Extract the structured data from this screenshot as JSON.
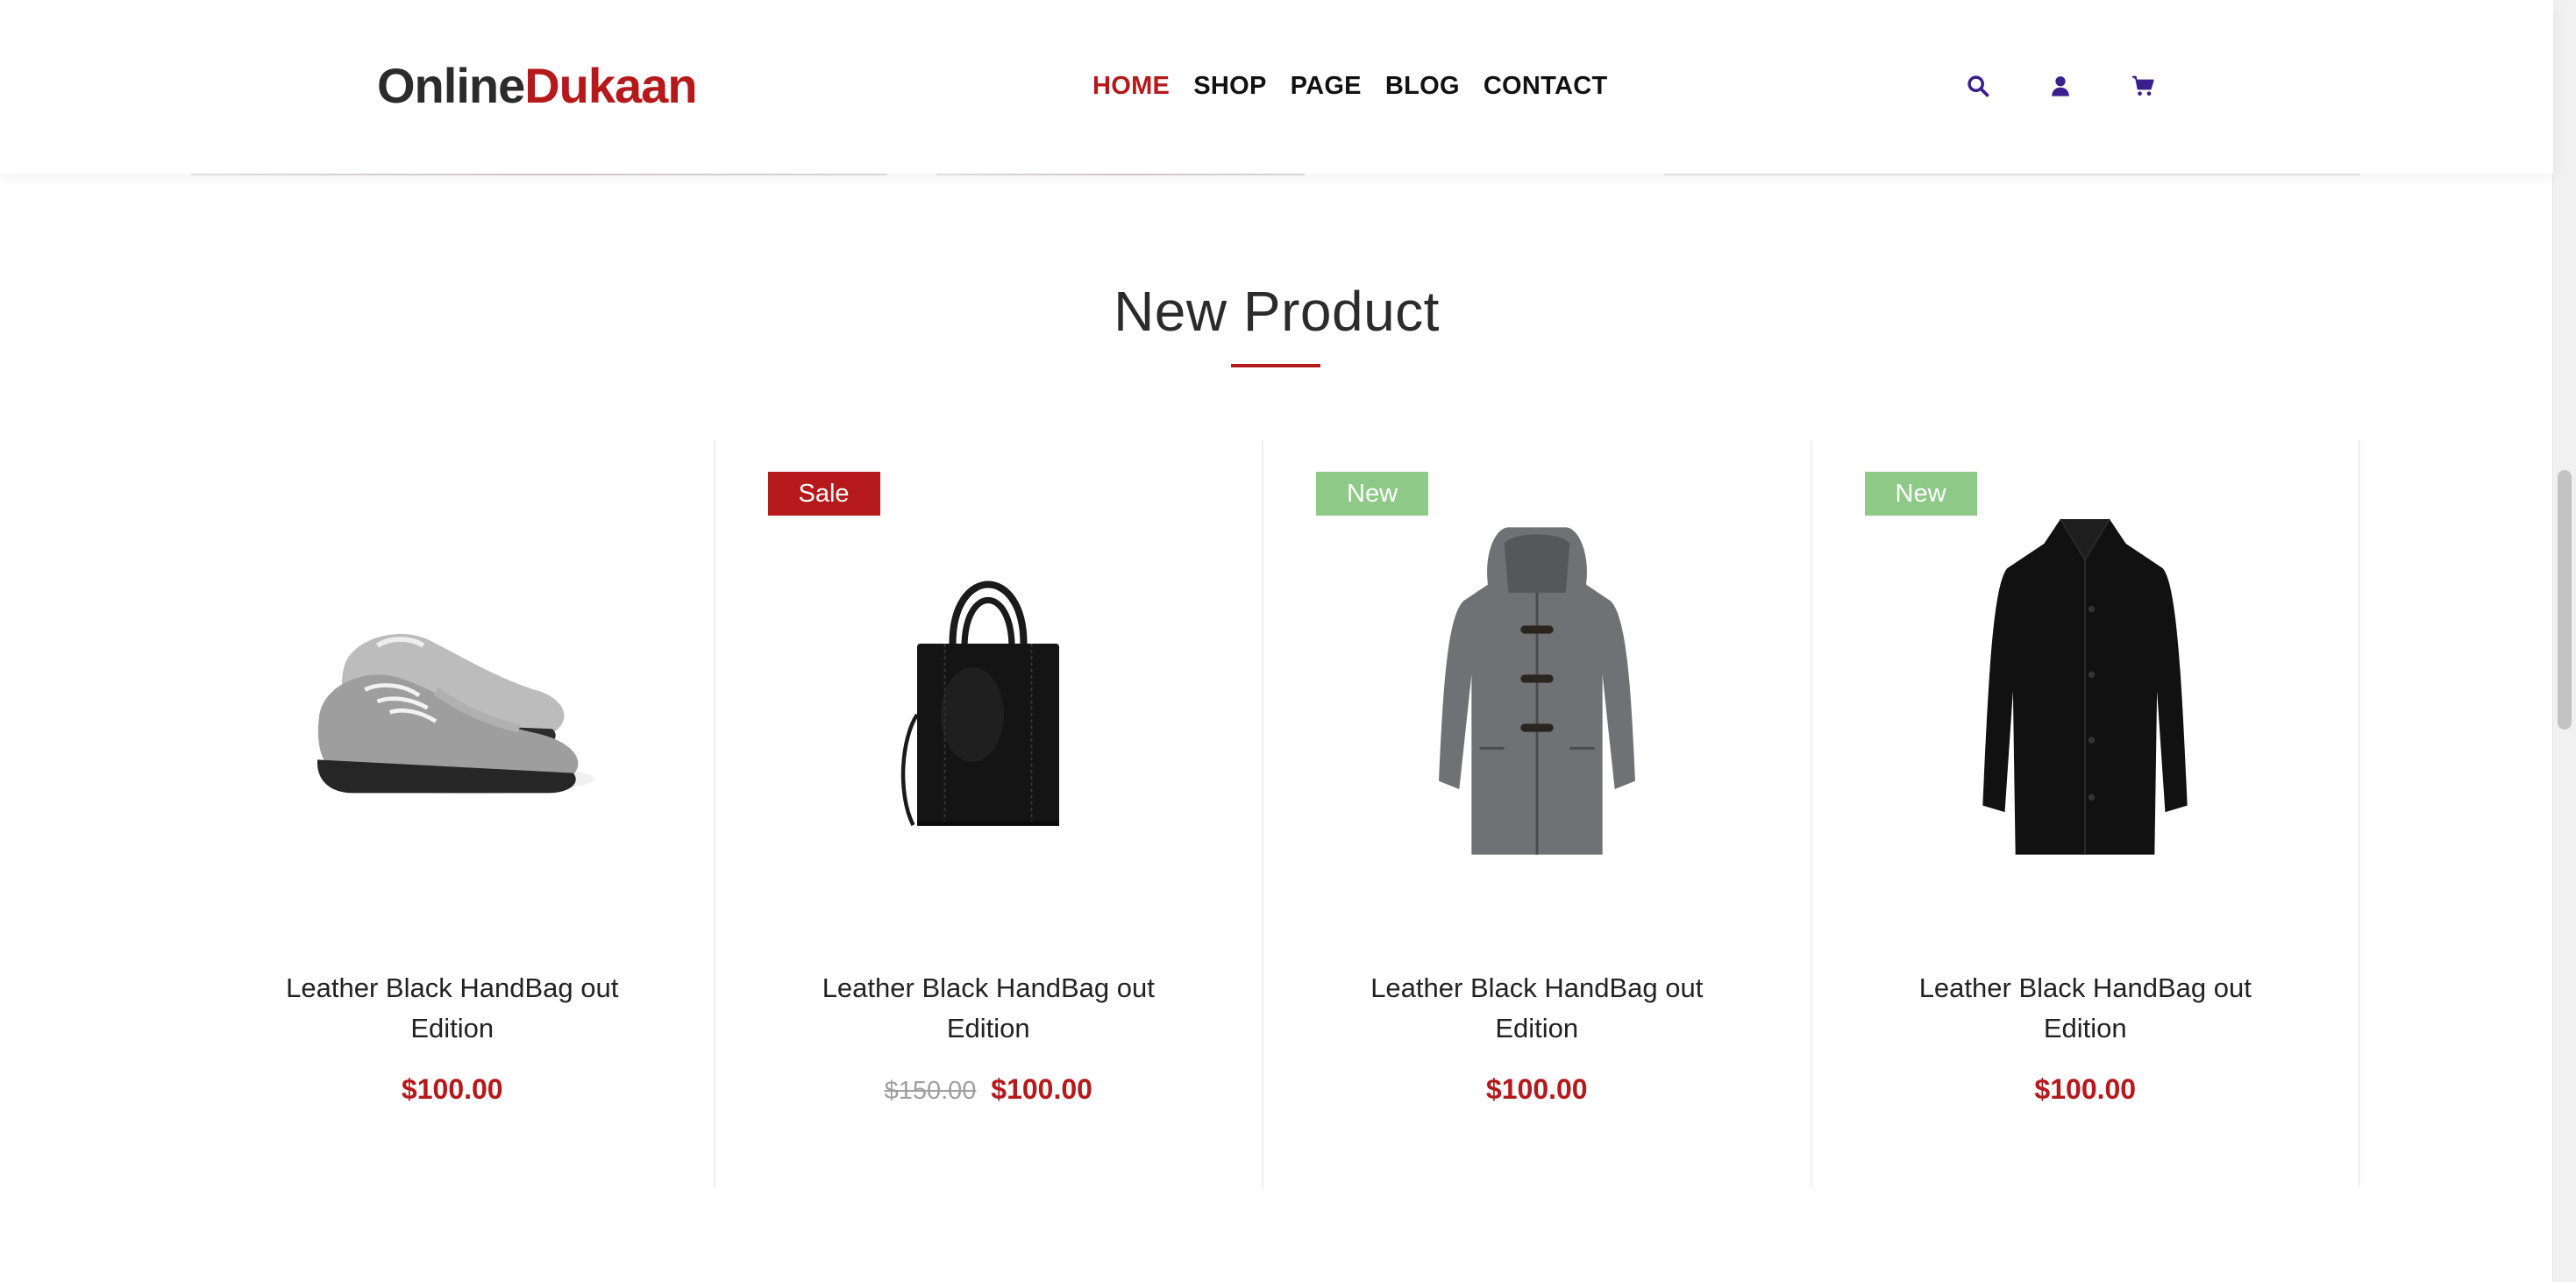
{
  "brand": {
    "part1": "Online",
    "part2": "Dukaan",
    "color_dark": "#2b2b2b",
    "color_accent": "#b5191b"
  },
  "nav": {
    "items": [
      {
        "label": "HOME",
        "active": true
      },
      {
        "label": "SHOP",
        "active": false
      },
      {
        "label": "PAGE",
        "active": false
      },
      {
        "label": "BLOG",
        "active": false
      },
      {
        "label": "CONTACT",
        "active": false
      }
    ]
  },
  "header_icons": [
    "search-icon",
    "user-icon",
    "cart-icon"
  ],
  "icon_color": "#3b1f8a",
  "section": {
    "title": "New Product"
  },
  "products": [
    {
      "badge": "",
      "image": "gray-sneakers",
      "name_line1": "Leather Black HandBag out",
      "name_line2": "Edition",
      "old_price": "",
      "price": "$100.00"
    },
    {
      "badge": "Sale",
      "image": "black-leather-tote-bag",
      "name_line1": "Leather Black HandBag out",
      "name_line2": "Edition",
      "old_price": "$150.00",
      "price": "$100.00"
    },
    {
      "badge": "New",
      "image": "gray-duffle-coat",
      "name_line1": "Leather Black HandBag out",
      "name_line2": "Edition",
      "old_price": "",
      "price": "$100.00"
    },
    {
      "badge": "New",
      "image": "black-overcoat",
      "name_line1": "Leather Black HandBag out",
      "name_line2": "Edition",
      "old_price": "",
      "price": "$100.00"
    }
  ]
}
